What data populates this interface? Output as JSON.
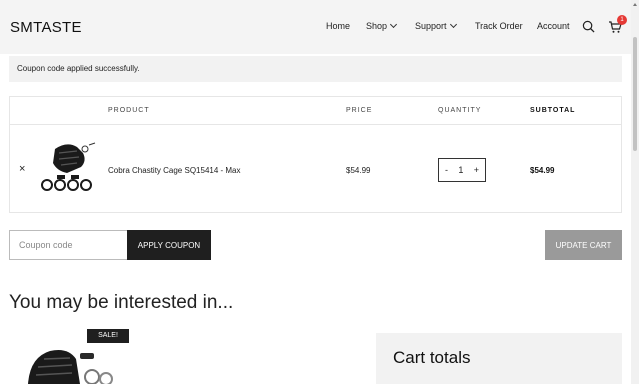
{
  "header": {
    "logo": "SMTASTE",
    "nav": [
      {
        "label": "Home",
        "dropdown": false
      },
      {
        "label": "Shop",
        "dropdown": true
      },
      {
        "label": "Support",
        "dropdown": true
      },
      {
        "label": "Track Order",
        "dropdown": false
      },
      {
        "label": "Account",
        "dropdown": false
      }
    ],
    "cart_count": "1",
    "icons": [
      "search-icon",
      "cart-icon"
    ]
  },
  "notice": "Coupon code applied successfully.",
  "table": {
    "headers": [
      "PRODUCT",
      "PRICE",
      "QUANTITY",
      "SUBTOTAL"
    ],
    "rows": [
      {
        "remove": "×",
        "product": "Cobra Chastity Cage SQ15414 - Max",
        "price": "$54.99",
        "quantity": "1",
        "minus": "-",
        "plus": "+",
        "subtotal": "$54.99"
      }
    ]
  },
  "coupon": {
    "placeholder": "Coupon code",
    "value": "",
    "apply_label": "APPLY COUPON",
    "update_label": "UPDATE CART"
  },
  "related": {
    "title": "You may be interested in...",
    "sale_badge": "SALE!"
  },
  "totals": {
    "title": "Cart totals"
  },
  "colors": {
    "header_bg": "#f4f4f4",
    "dark_button": "#1f1f1f",
    "disabled_button": "#9a9a9a",
    "badge": "#e53935"
  }
}
